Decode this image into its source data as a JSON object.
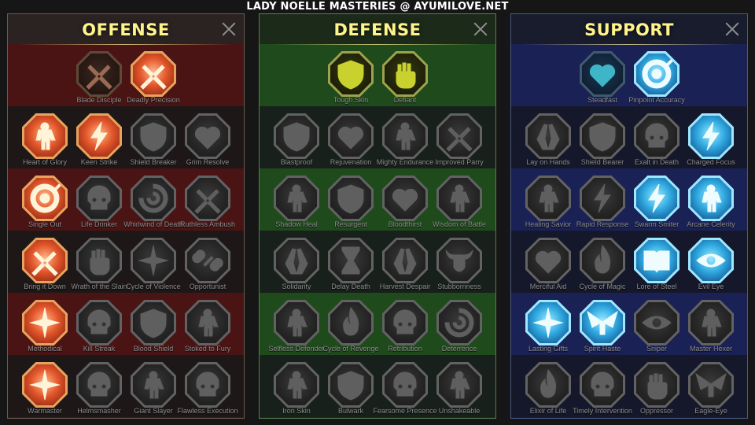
{
  "page_title": "LADY NOELLE MASTERIES @ AYUMILOVE.NET",
  "icons": {
    "blade": "<path d='M18 40 L40 18 L43 21 L21 43 Z M40 40 L18 18 L15 21 L37 43 Z M22 42 l-6 6 l-3-3 l6-6z M36 42 l6 6 l3-3 l-6-6z'/>",
    "fist": "<path d='M19 26 h20 a3 3 0 0 1 3 3 v9 a9 9 0 0 1 -9 9 h-6 a9 9 0 0 1 -9 -9 v-9 a3 3 0 0 1 1 -3z M20 17 h4 v9 h-4z M26 15 h4 v11 h-4z M32 16 h4 v10 h-4z'/>",
    "shield": "<path d='M29 12 L45 18 V29 C45 39 38 45 29 48 C20 45 13 39 13 29 V18 Z'/>",
    "heart": "<path d='M29 45 L15 31 a8 8 0 0 1 14 -10 a8 8 0 0 1 14 10 Z'/>",
    "skull": "<path d='M29 13 a14 13 0 0 1 14 13 v6 l-4 4 v7 h-20 v-7 l-4 -4 v-6 a14 13 0 0 1 14 -13z M23 28 a3 3 0 1 0 0.1 0z M35 28 a3 3 0 1 0 0.1 0z'/>",
    "bolt": "<path d='M32 11 L19 31 H28 L24 47 L39 25 H30 Z'/>",
    "burst": "<path d='M29 10 L32 25 L47 29 L32 33 L29 48 L26 33 L11 29 L26 25 Z'/>",
    "figure": "<path d='M29 12 a5 5 0 1 1 -0.1 0z M21 21 h16 l5 13 h-5 l-2 -6 v18 h-4 v-10 h-2 v10 h-4 v-18 l-2 6 h-5z'/>",
    "eye": "<path d='M11 29 Q29 13 47 29 Q29 45 11 29z M29 23 a6 6 0 1 0 0.1 0z'/>",
    "book": "<path d='M13 17 h12 a4 4 0 0 1 4 4 v23 a4 4 0 0 0 -4 -3 h-12z M45 17 h-12 a4 4 0 0 0 -4 4 v23 a4 4 0 0 1 4 -3 h12z'/>",
    "hourglass": "<path d='M18 12 h22 v4 l-8 13 l8 13 v4 h-22 v-4 l8 -13 l-8 -13z'/>",
    "hands": "<path d='M22 46 L15 33 L24 14 L28 15 L25 32 L29 46z M36 46 L43 33 L34 14 L30 15 L33 32 L29 46z'/>",
    "bull": "<path d='M12 16 Q14 27 22 27 L22 38 Q29 48 36 38 L36 27 Q44 27 46 16 Q42 22 36 22 L22 22 Q16 22 12 16z'/>",
    "swirl": "<path d='M29 11 a18 18 0 1 1 -18 18 h5 a13 13 0 1 0 13 -13z M29 21 a8 8 0 1 1 -8 8 h4 a4 4 0 1 0 4 -4z'/>",
    "target": "<path d='M29 11 a18 18 0 1 1 -0.1 0z M29 17 a12 12 0 1 0 0.1 0z M29 23 a6 6 0 1 1 -0.1 0z M38 20 l9 -9 l2 2 l-9 9z'/>",
    "wings": "<path d='M29 28 L10 15 L16 35 Z M29 28 L48 15 L42 35 Z M26 28 h6 v16 h-6z'/>",
    "chains": "<path d='M14 20 a6 6 0 1 1 10 6 l-4 4 a6 6 0 1 1 -6 -10z M44 38 a6 6 0 1 1 -10 -6 l4 -4 a6 6 0 1 1 6 10z M24 34 l10 -10 l2 2 l-10 10z'/>",
    "flame": "<path d='M29 10 Q41 24 38 36 a9 9 0 0 1 -18 0 Q18 28 25 22 Q25 30 29 32 Q26 20 29 10z'/>"
  },
  "panels": [
    {
      "name": "offense",
      "title": "OFFENSE",
      "border": "#6a5a4e",
      "bg": "#2b2322",
      "band": "#4a1414",
      "band_dark": "#1d1717",
      "skills": [
        {
          "label": "Blade Disciple",
          "icon": "blade",
          "state": "off-dim"
        },
        {
          "label": "Deadly Precision",
          "icon": "blade",
          "state": "off-active"
        },
        {
          "label": "Heart of Glory",
          "icon": "figure",
          "state": "off-active"
        },
        {
          "label": "Keen Strike",
          "icon": "bolt",
          "state": "off-active"
        },
        {
          "label": "Shield Breaker",
          "icon": "shield",
          "state": "inactive"
        },
        {
          "label": "Grim Resolve",
          "icon": "heart",
          "state": "inactive"
        },
        {
          "label": "Single Out",
          "icon": "target",
          "state": "off-active"
        },
        {
          "label": "Life Drinker",
          "icon": "skull",
          "state": "inactive"
        },
        {
          "label": "Whirlwind of Death",
          "icon": "swirl",
          "state": "inactive"
        },
        {
          "label": "Ruthless Ambush",
          "icon": "blade",
          "state": "inactive"
        },
        {
          "label": "Bring it Down",
          "icon": "blade",
          "state": "off-active"
        },
        {
          "label": "Wrath of the Slain",
          "icon": "fist",
          "state": "inactive"
        },
        {
          "label": "Cycle of Violence",
          "icon": "burst",
          "state": "inactive"
        },
        {
          "label": "Opportunist",
          "icon": "chains",
          "state": "inactive"
        },
        {
          "label": "Methodical",
          "icon": "burst",
          "state": "off-active"
        },
        {
          "label": "Kill Streak",
          "icon": "skull",
          "state": "inactive"
        },
        {
          "label": "Blood Shield",
          "icon": "shield",
          "state": "inactive"
        },
        {
          "label": "Stoked to Fury",
          "icon": "figure",
          "state": "inactive"
        },
        {
          "label": "Warmaster",
          "icon": "burst",
          "state": "off-active"
        },
        {
          "label": "Helmsmasher",
          "icon": "skull",
          "state": "inactive"
        },
        {
          "label": "Giant Slayer",
          "icon": "figure",
          "state": "inactive"
        },
        {
          "label": "Flawless Execution",
          "icon": "skull",
          "state": "inactive"
        }
      ]
    },
    {
      "name": "defense",
      "title": "DEFENSE",
      "border": "#56804a",
      "bg": "#1c2a1a",
      "band": "#1f4a1c",
      "band_dark": "#17201a",
      "skills": [
        {
          "label": "Tough Skin",
          "icon": "shield",
          "state": "def-active"
        },
        {
          "label": "Defiant",
          "icon": "fist",
          "state": "def-active"
        },
        {
          "label": "Blastproof",
          "icon": "shield",
          "state": "inactive"
        },
        {
          "label": "Rejuvenation",
          "icon": "heart",
          "state": "inactive"
        },
        {
          "label": "Mighty Endurance",
          "icon": "figure",
          "state": "inactive"
        },
        {
          "label": "Improved Parry",
          "icon": "blade",
          "state": "inactive"
        },
        {
          "label": "Shadow Heal",
          "icon": "figure",
          "state": "inactive"
        },
        {
          "label": "Resurgent",
          "icon": "shield",
          "state": "inactive"
        },
        {
          "label": "Bloodthirst",
          "icon": "heart",
          "state": "inactive"
        },
        {
          "label": "Wisdom of Battle",
          "icon": "figure",
          "state": "inactive"
        },
        {
          "label": "Solidarity",
          "icon": "hands",
          "state": "inactive"
        },
        {
          "label": "Delay Death",
          "icon": "hourglass",
          "state": "inactive"
        },
        {
          "label": "Harvest Despair",
          "icon": "hands",
          "state": "inactive"
        },
        {
          "label": "Stubbornness",
          "icon": "bull",
          "state": "inactive"
        },
        {
          "label": "Selfless Defender",
          "icon": "figure",
          "state": "inactive"
        },
        {
          "label": "Cycle of Revenge",
          "icon": "flame",
          "state": "inactive"
        },
        {
          "label": "Retribution",
          "icon": "skull",
          "state": "inactive"
        },
        {
          "label": "Deterrence",
          "icon": "swirl",
          "state": "inactive"
        },
        {
          "label": "Iron Skin",
          "icon": "figure",
          "state": "inactive"
        },
        {
          "label": "Bulwark",
          "icon": "shield",
          "state": "inactive"
        },
        {
          "label": "Fearsome Presence",
          "icon": "skull",
          "state": "inactive"
        },
        {
          "label": "Unshakeable",
          "icon": "figure",
          "state": "inactive"
        }
      ]
    },
    {
      "name": "support",
      "title": "SUPPORT",
      "border": "#4a5a86",
      "bg": "#181c2c",
      "band": "#1a2155",
      "band_dark": "#15182a",
      "skills": [
        {
          "label": "Steadfast",
          "icon": "heart",
          "state": "sup-dim"
        },
        {
          "label": "Pinpoint Accuracy",
          "icon": "target",
          "state": "sup-active"
        },
        {
          "label": "Lay on Hands",
          "icon": "hands",
          "state": "inactive"
        },
        {
          "label": "Shield Bearer",
          "icon": "shield",
          "state": "inactive"
        },
        {
          "label": "Exalt in Death",
          "icon": "skull",
          "state": "inactive"
        },
        {
          "label": "Charged Focus",
          "icon": "bolt",
          "state": "sup-active"
        },
        {
          "label": "Healing Savior",
          "icon": "figure",
          "state": "inactive"
        },
        {
          "label": "Rapid Response",
          "icon": "bolt",
          "state": "inactive"
        },
        {
          "label": "Swarm Smiter",
          "icon": "bolt",
          "state": "sup-active"
        },
        {
          "label": "Arcane Celerity",
          "icon": "figure",
          "state": "sup-active"
        },
        {
          "label": "Merciful Aid",
          "icon": "heart",
          "state": "inactive"
        },
        {
          "label": "Cycle of Magic",
          "icon": "flame",
          "state": "inactive"
        },
        {
          "label": "Lore of Steel",
          "icon": "book",
          "state": "sup-active"
        },
        {
          "label": "Evil Eye",
          "icon": "eye",
          "state": "sup-active"
        },
        {
          "label": "Lasting Gifts",
          "icon": "burst",
          "state": "sup-active"
        },
        {
          "label": "Spirit Haste",
          "icon": "wings",
          "state": "sup-active"
        },
        {
          "label": "Sniper",
          "icon": "eye",
          "state": "inactive"
        },
        {
          "label": "Master Hexer",
          "icon": "figure",
          "state": "inactive"
        },
        {
          "label": "Elixir of Life",
          "icon": "flame",
          "state": "inactive"
        },
        {
          "label": "Timely Intervention",
          "icon": "skull",
          "state": "inactive"
        },
        {
          "label": "Oppressor",
          "icon": "fist",
          "state": "inactive"
        },
        {
          "label": "Eagle-Eye",
          "icon": "wings",
          "state": "inactive"
        }
      ]
    }
  ]
}
